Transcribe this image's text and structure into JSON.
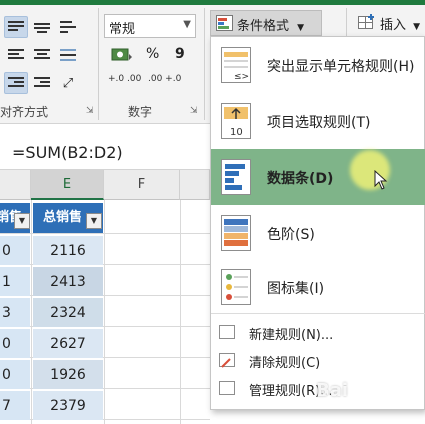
{
  "ribbon": {
    "number_format_value": "常规",
    "percent_symbol": "%",
    "comma_symbol": "9",
    "increase_decimal": "+.0 .00",
    "decrease_decimal": ".00 +.0",
    "alignment_group_label": "对齐方式",
    "number_group_label": "数字",
    "conditional_format_label": "条件格式",
    "insert_label": "插入"
  },
  "formula_bar": {
    "formula": "=SUM(B2:D2)"
  },
  "columns": {
    "e": "E",
    "f": "F"
  },
  "table": {
    "header_left": "销售",
    "header_e": "总销售",
    "rows": [
      {
        "d": "0",
        "e": "2116"
      },
      {
        "d": "1",
        "e": "2413"
      },
      {
        "d": "3",
        "e": "2324"
      },
      {
        "d": "0",
        "e": "2627"
      },
      {
        "d": "0",
        "e": "1926"
      },
      {
        "d": "7",
        "e": "2379"
      }
    ]
  },
  "menu": {
    "items": [
      {
        "label": "突出显示单元格规则(H)",
        "icon": "highlight-cells-icon"
      },
      {
        "label": "项目选取规则(T)",
        "icon": "top-bottom-rules-icon"
      },
      {
        "label": "数据条(D)",
        "icon": "data-bars-icon"
      },
      {
        "label": "色阶(S)",
        "icon": "color-scales-icon"
      },
      {
        "label": "图标集(I)",
        "icon": "icon-sets-icon"
      }
    ],
    "actions": [
      {
        "label": "新建规则(N)..."
      },
      {
        "label": "清除规则(C)"
      },
      {
        "label": "管理规则(R)..."
      }
    ],
    "highlight_color": "#7fb489"
  },
  "watermark": "Bai"
}
